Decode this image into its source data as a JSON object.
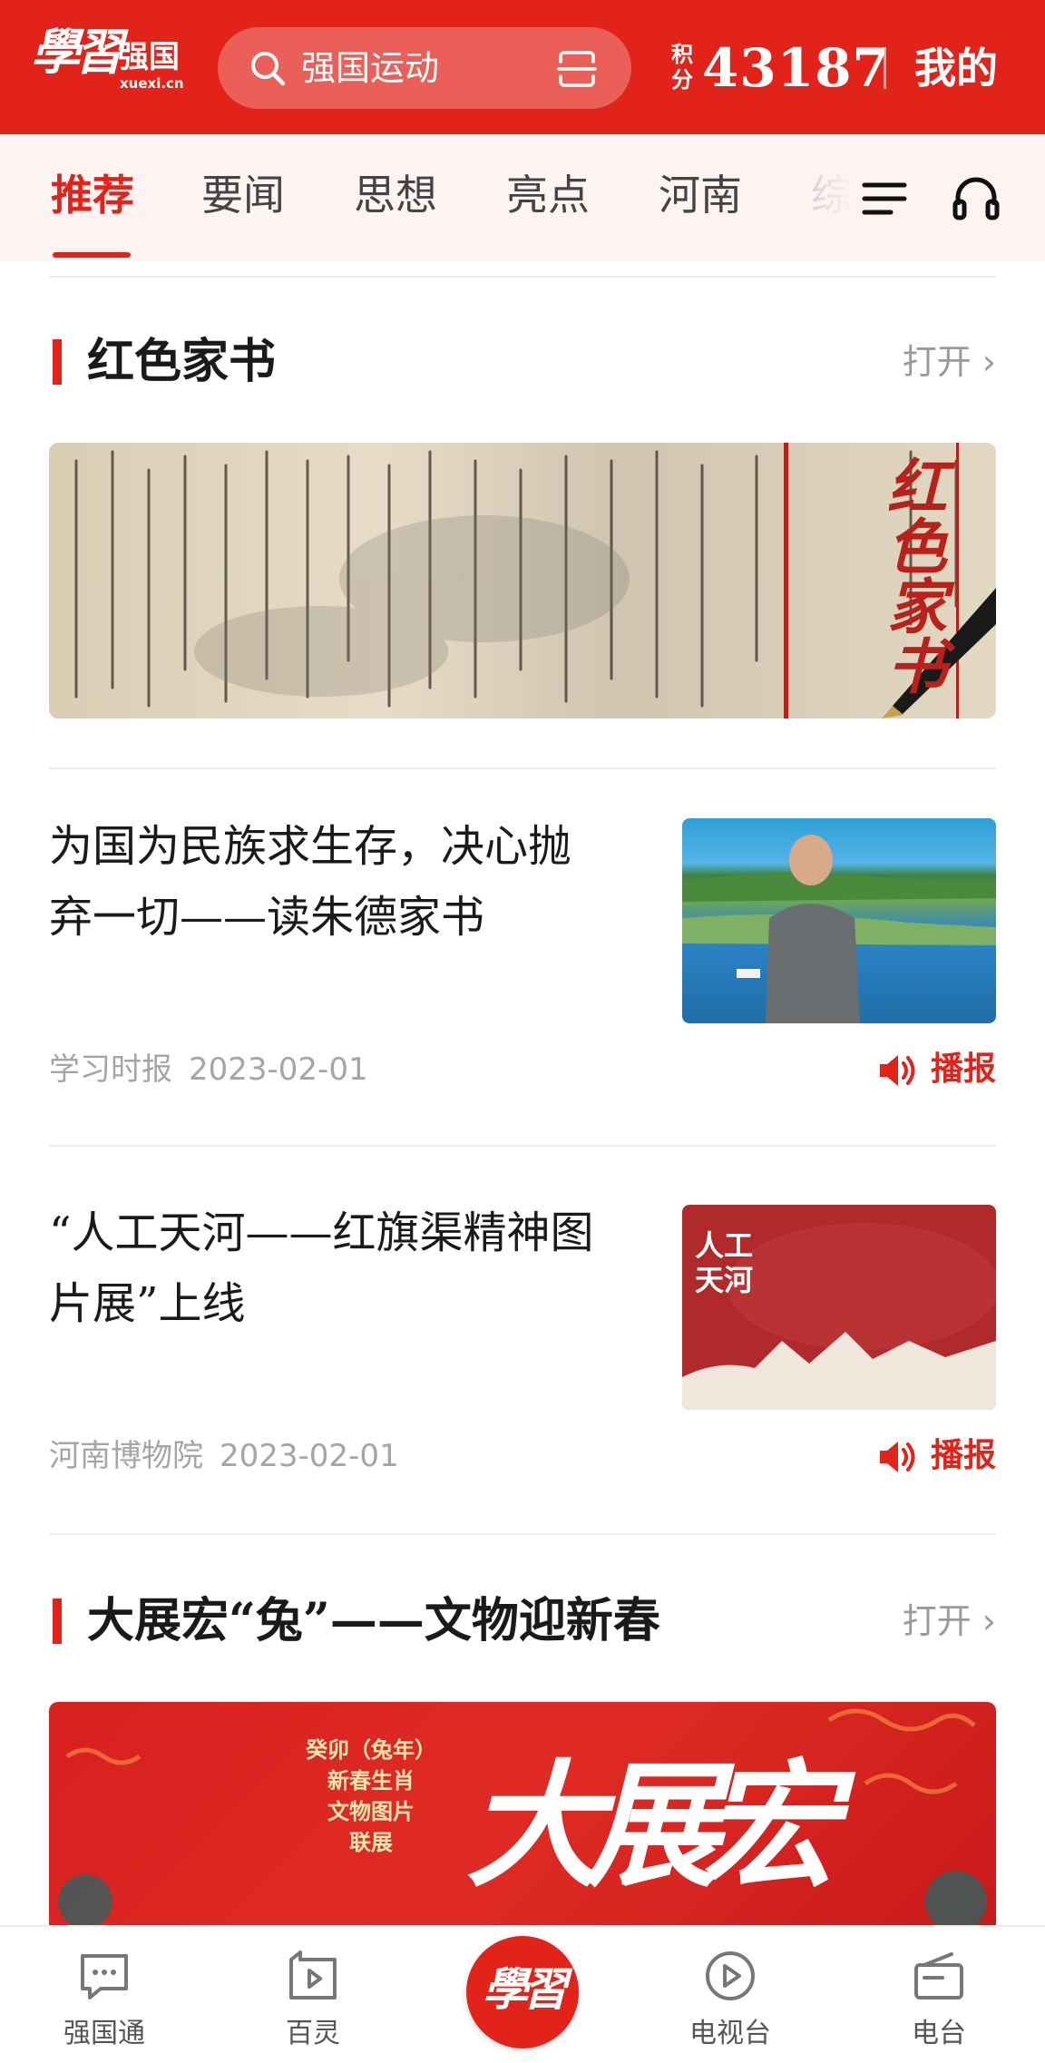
{
  "header": {
    "logo_script": "學習",
    "logo_name": "强国",
    "logo_url": "xuexi.cn",
    "search_placeholder": "强国运动",
    "points_label": "积分",
    "points_value": "43187",
    "mine_label": "我的"
  },
  "tabs": [
    {
      "label": "推荐",
      "active": true
    },
    {
      "label": "要闻",
      "active": false
    },
    {
      "label": "思想",
      "active": false
    },
    {
      "label": "亮点",
      "active": false
    },
    {
      "label": "河南",
      "active": false
    },
    {
      "label": "综",
      "active": false
    }
  ],
  "sections": [
    {
      "title": "红色家书",
      "open_label": "打开 ›",
      "banner_text": "红色家书"
    },
    {
      "title": "大展宏“兔”——文物迎新春",
      "open_label": "打开 ›",
      "banner_caption_lines": [
        "癸卯（兔年）",
        "新春生肖",
        "文物图片",
        "联展"
      ],
      "banner_big_text": "大展宏"
    }
  ],
  "articles": [
    {
      "title_line1": "为国为民族求生存，决心抛",
      "title_line2": "弃一切——读朱德家书",
      "source": "学习时报",
      "date": "2023-02-01",
      "play_label": "播报"
    },
    {
      "title_line1": "“人工天河——红旗渠精神图",
      "title_line2": "片展”上线",
      "source": "河南博物院",
      "date": "2023-02-01",
      "play_label": "播报",
      "thumb_text_1": "人工",
      "thumb_text_2": "天河"
    }
  ],
  "bottom_nav": [
    {
      "label": "强国通",
      "icon": "chat-icon"
    },
    {
      "label": "百灵",
      "icon": "video-icon"
    },
    {
      "label": "學習",
      "icon": "xuexi-home-icon"
    },
    {
      "label": "电视台",
      "icon": "play-circle-icon"
    },
    {
      "label": "电台",
      "icon": "radio-icon"
    }
  ],
  "colors": {
    "brand_red": "#e2231a",
    "tab_bg": "#fdf3f2",
    "meta_gray": "#a5a5a5"
  }
}
